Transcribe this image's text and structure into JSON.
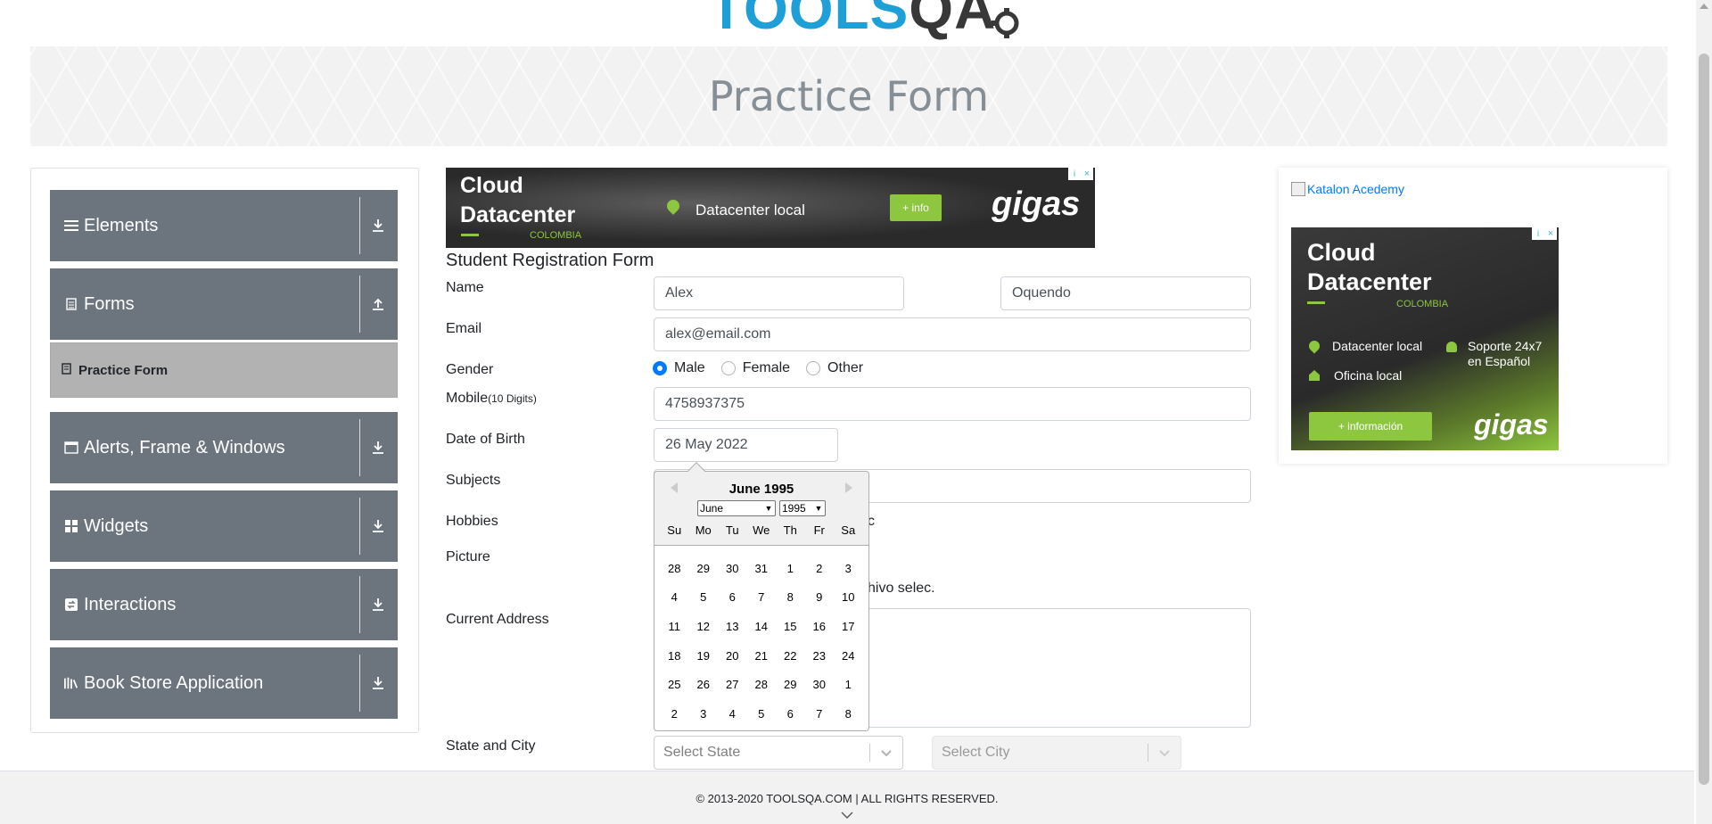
{
  "logo": {
    "left": "TOOLS",
    "right": "QA"
  },
  "banner": {
    "title": "Practice Form"
  },
  "sidebar": {
    "groups": [
      {
        "label": "Elements",
        "icon": "hamburger-icon",
        "arrow": "download-arrow-icon"
      },
      {
        "label": "Forms",
        "icon": "document-icon",
        "arrow": "upload-arrow-icon"
      },
      {
        "label": "Alerts, Frame & Windows",
        "icon": "window-icon",
        "arrow": "download-arrow-icon"
      },
      {
        "label": "Widgets",
        "icon": "grid-icon",
        "arrow": "download-arrow-icon"
      },
      {
        "label": "Interactions",
        "icon": "interaction-icon",
        "arrow": "download-arrow-icon"
      },
      {
        "label": "Book Store Application",
        "icon": "books-icon",
        "arrow": "download-arrow-icon"
      }
    ],
    "active_item": {
      "label": "Practice Form",
      "icon": "form-icon"
    }
  },
  "ad_top": {
    "title_line1": "Cloud",
    "title_line2": "Datacenter",
    "country": "COLOMBIA",
    "feature": "Datacenter local",
    "button": "+ info",
    "brand": "gigas"
  },
  "form": {
    "title": "Student Registration Form",
    "labels": {
      "name": "Name",
      "email": "Email",
      "gender": "Gender",
      "mobile": "Mobile",
      "mobile_hint": "(10 Digits)",
      "dob": "Date of Birth",
      "subjects": "Subjects",
      "hobbies": "Hobbies",
      "picture": "Picture",
      "address": "Current Address",
      "state_city": "State and City"
    },
    "first_name": "Alex",
    "last_name": "Oquendo",
    "email": "alex@email.com",
    "gender_options": [
      "Male",
      "Female",
      "Other"
    ],
    "gender_selected": "Male",
    "mobile": "4758937375",
    "dob": "26 May 2022",
    "hobbies_partial": "c",
    "picture_partial": "hivo selec.",
    "state_placeholder": "Select State",
    "city_placeholder": "Select City"
  },
  "calendar": {
    "header": "June 1995",
    "month_select": "June",
    "year_select": "1995",
    "weekdays": [
      "Su",
      "Mo",
      "Tu",
      "We",
      "Th",
      "Fr",
      "Sa"
    ],
    "weeks": [
      [
        "28",
        "29",
        "30",
        "31",
        "1",
        "2",
        "3"
      ],
      [
        "4",
        "5",
        "6",
        "7",
        "8",
        "9",
        "10"
      ],
      [
        "11",
        "12",
        "13",
        "14",
        "15",
        "16",
        "17"
      ],
      [
        "18",
        "19",
        "20",
        "21",
        "22",
        "23",
        "24"
      ],
      [
        "25",
        "26",
        "27",
        "28",
        "29",
        "30",
        "1"
      ],
      [
        "2",
        "3",
        "4",
        "5",
        "6",
        "7",
        "8"
      ]
    ]
  },
  "ad_right": {
    "broken_image_alt": "Katalon Acedemy",
    "title_line1": "Cloud",
    "title_line2": "Datacenter",
    "country": "COLOMBIA",
    "feature1": "Datacenter local",
    "feature2_line1": "Soporte 24x7",
    "feature2_line2": "en Español",
    "feature3": "Oficina local",
    "button": "+ información",
    "brand": "gigas"
  },
  "footer": {
    "text": "© 2013-2020 TOOLSQA.COM | ALL RIGHTS RESERVED."
  }
}
